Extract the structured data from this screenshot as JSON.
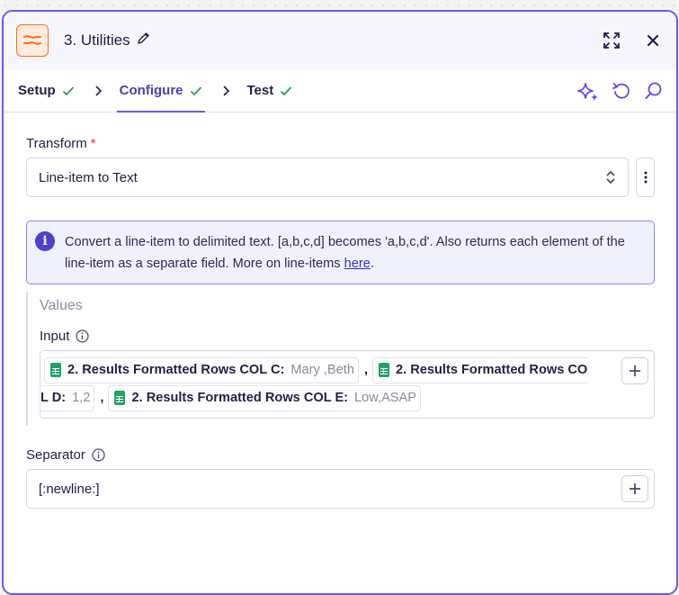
{
  "colors": {
    "accent": "#695be8",
    "brand_orange": "#ff6a1a",
    "sheets_green": "#21a464",
    "required": "#d6343c"
  },
  "header": {
    "title": "3. Utilities"
  },
  "tabs": [
    {
      "label": "Setup",
      "complete": true
    },
    {
      "label": "Configure",
      "complete": true,
      "active": true
    },
    {
      "label": "Test",
      "complete": true
    }
  ],
  "transform": {
    "label": "Transform",
    "required_mark": "*",
    "selected": "Line-item to Text"
  },
  "info": {
    "text": "Convert a line-item to delimited text. [a,b,c,d] becomes 'a,b,c,d'. Also returns each element of the line-item as a separate field. More on line-items",
    "link": "here",
    "suffix": "."
  },
  "values": {
    "title": "Values",
    "input": {
      "label": "Input",
      "pills": [
        {
          "key": "2. Results Formatted Rows COL C:",
          "value": "Mary ,Beth"
        },
        {
          "key": "2. Results Formatted Rows CO",
          "value": ""
        },
        {
          "key": "L D:",
          "value": "1,2"
        },
        {
          "key": "2. Results Formatted Rows COL E:",
          "value": "Low,ASAP"
        }
      ],
      "separator_char": ","
    }
  },
  "separator": {
    "label": "Separator",
    "value": "[:newline:]"
  }
}
